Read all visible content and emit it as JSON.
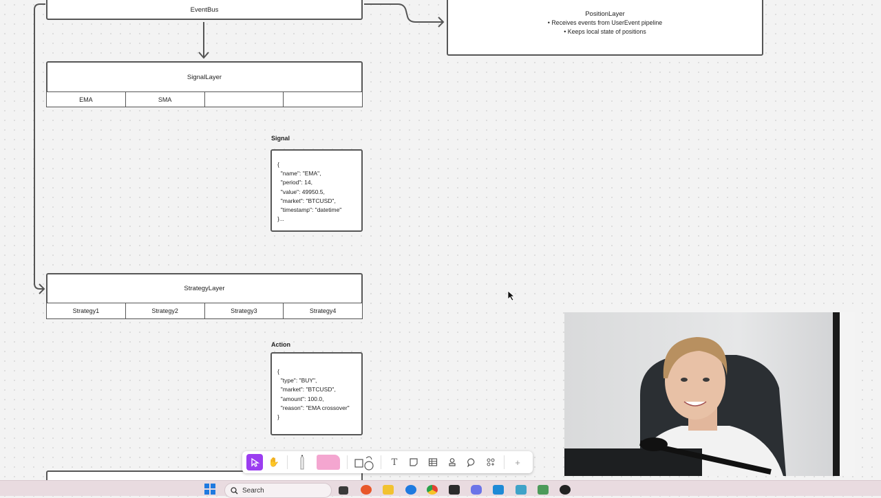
{
  "diagram": {
    "event_bus": {
      "title": "EventBus"
    },
    "position_layer": {
      "title": "PositionLayer",
      "bullets": [
        "Receives events from UserEvent pipeline",
        "Keeps local state of positions"
      ]
    },
    "signal_layer": {
      "title": "SignalLayer",
      "cells": [
        "EMA",
        "SMA",
        "",
        ""
      ]
    },
    "signal": {
      "label": "Signal",
      "code": "{\n  \"name\": \"EMA\",\n  \"period\": 14,\n  \"value\": 49950.5,\n  \"market\": \"BTCUSD\",\n  \"timestamp\": \"datetime\"\n}..."
    },
    "strategy_layer": {
      "title": "StrategyLayer",
      "cells": [
        "Strategy1",
        "Strategy2",
        "Strategy3",
        "Strategy4"
      ]
    },
    "action": {
      "label": "Action",
      "code": "{\n  \"type\": \"BUY\",\n  \"market\": \"BTCUSD\",\n  \"amount\": 100.0,\n  \"reason\": \"EMA crossover\"\n}"
    }
  },
  "toolbar": {
    "tools": [
      "select-tool",
      "hand-tool",
      "pen-tool",
      "highlighter-tool",
      "shape-tool",
      "text-tool",
      "sticky-tool",
      "table-tool",
      "stamp-tool",
      "comment-tool",
      "more-tools",
      "add-tool"
    ]
  },
  "taskbar": {
    "search_placeholder": "Search",
    "accent": "#1f7ae0"
  },
  "colors": {
    "canvas": "#f3f3f3",
    "stroke": "#555555",
    "active_tool": "#9b3df0"
  }
}
